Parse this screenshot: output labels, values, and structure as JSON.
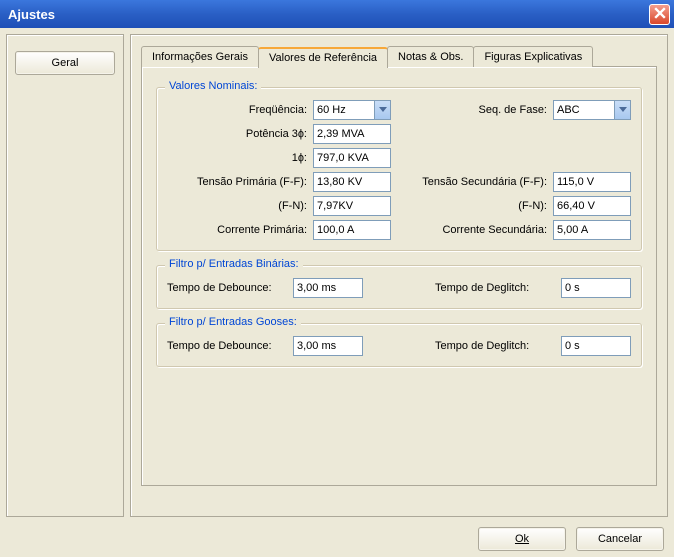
{
  "window": {
    "title": "Ajustes"
  },
  "sidebar": {
    "items": [
      {
        "label": "Geral"
      }
    ]
  },
  "tabs": [
    {
      "label": "Informações Gerais"
    },
    {
      "label": "Valores de Referência"
    },
    {
      "label": "Notas & Obs."
    },
    {
      "label": "Figuras Explicativas"
    }
  ],
  "groups": {
    "nominal": {
      "legend": "Valores Nominais:",
      "freq_label": "Freqüência:",
      "freq_value": "60 Hz",
      "seq_label": "Seq. de Fase:",
      "seq_value": "ABC",
      "pot3_label": "Potência 3ɸ:",
      "pot3_value": "2,39 MVA",
      "pot1_label": "1ɸ:",
      "pot1_value": "797,0 KVA",
      "vprim_ff_label": "Tensão Primária (F-F):",
      "vprim_ff_value": "13,80 KV",
      "vsec_ff_label": "Tensão Secundária (F-F):",
      "vsec_ff_value": "115,0 V",
      "fn_label_left": "(F-N):",
      "vprim_fn_value": "7,97KV",
      "fn_label_right": "(F-N):",
      "vsec_fn_value": "66,40 V",
      "iprim_label": "Corrente Primária:",
      "iprim_value": "100,0 A",
      "isec_label": "Corrente Secundária:",
      "isec_value": "5,00 A"
    },
    "binary": {
      "legend": "Filtro p/ Entradas Binárias:",
      "debounce_label": "Tempo de Debounce:",
      "debounce_value": "3,00 ms",
      "deglitch_label": "Tempo de Deglitch:",
      "deglitch_value": "0 s"
    },
    "goose": {
      "legend": "Filtro p/ Entradas Gooses:",
      "debounce_label": "Tempo de Debounce:",
      "debounce_value": "3,00 ms",
      "deglitch_label": "Tempo de Deglitch:",
      "deglitch_value": "0 s"
    }
  },
  "buttons": {
    "ok": "Ok",
    "cancel": "Cancelar"
  }
}
